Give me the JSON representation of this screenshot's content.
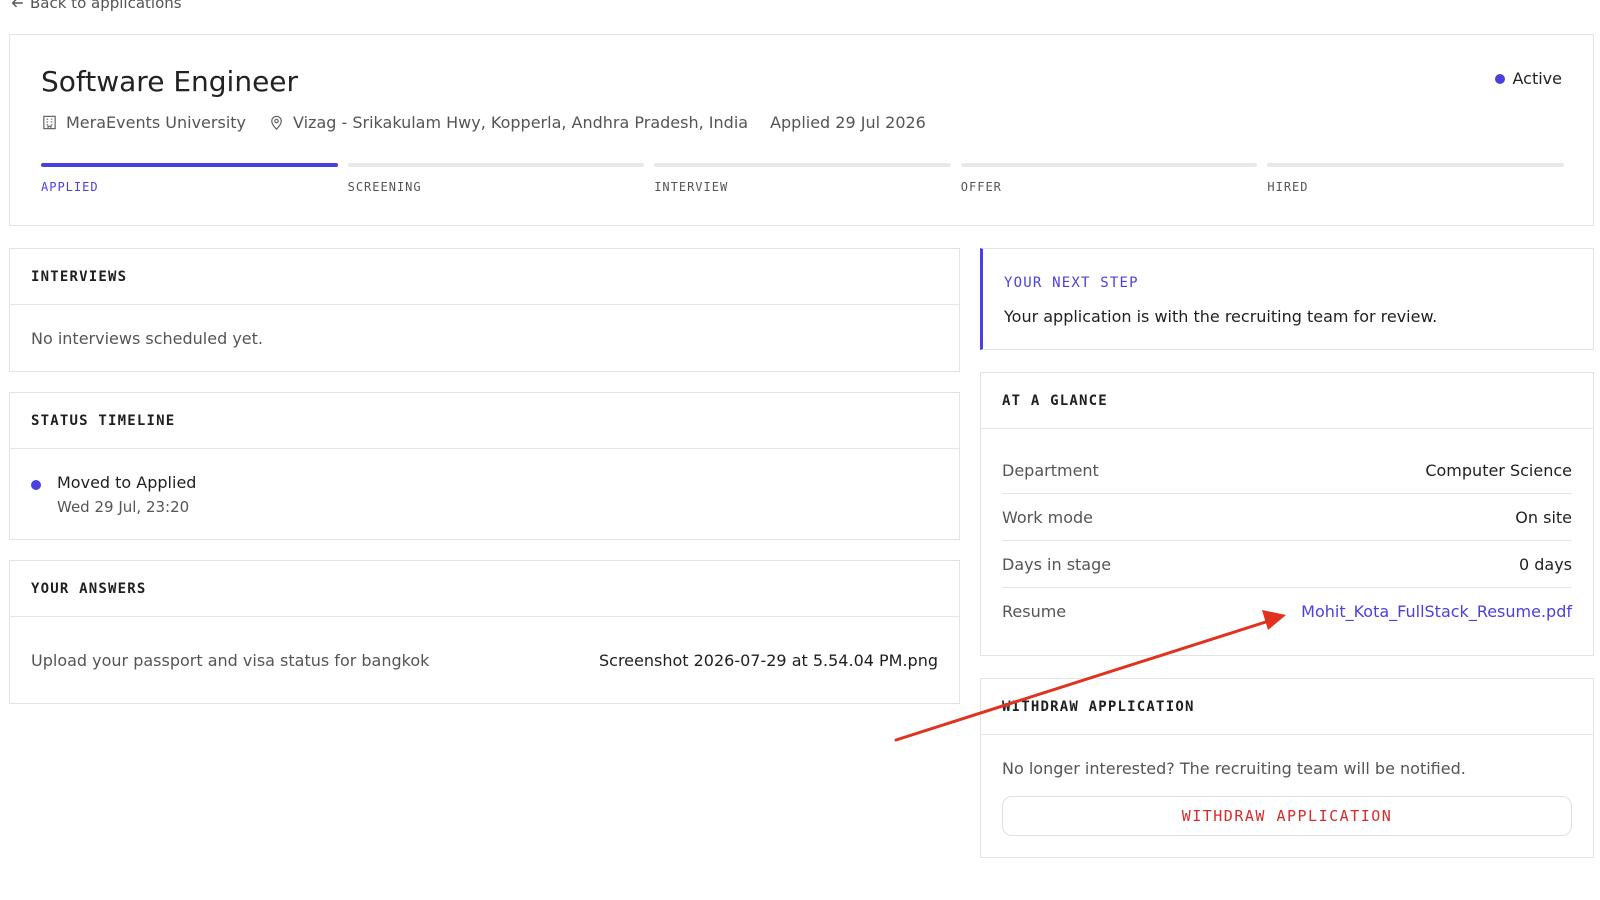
{
  "back_link": {
    "label": "Back to applications"
  },
  "header": {
    "title": "Software Engineer",
    "status": "Active",
    "organization": "MeraEvents University",
    "location": "Vizag - Srikakulam Hwy, Kopperla, Andhra Pradesh, India",
    "applied": "Applied 29 Jul 2026"
  },
  "stages": [
    "APPLIED",
    "SCREENING",
    "INTERVIEW",
    "OFFER",
    "HIRED"
  ],
  "interviews": {
    "heading": "INTERVIEWS",
    "empty_text": "No interviews scheduled yet."
  },
  "timeline": {
    "heading": "STATUS TIMELINE",
    "entries": [
      {
        "title": "Moved to Applied",
        "date": "Wed 29 Jul, 23:20"
      }
    ]
  },
  "answers": {
    "heading": "YOUR ANSWERS",
    "items": [
      {
        "question": "Upload your passport and visa status for bangkok",
        "answer": "Screenshot 2026-07-29 at 5.54.04 PM.png"
      }
    ]
  },
  "next_step": {
    "heading": "YOUR NEXT STEP",
    "text": "Your application is with the recruiting team for review."
  },
  "glance": {
    "heading": "AT A GLANCE",
    "rows": [
      {
        "key": "Department",
        "value": "Computer Science"
      },
      {
        "key": "Work mode",
        "value": "On site"
      },
      {
        "key": "Days in stage",
        "value": "0 days"
      },
      {
        "key": "Resume",
        "value": "Mohit_Kota_FullStack_Resume.pdf"
      }
    ]
  },
  "withdraw": {
    "heading": "WITHDRAW APPLICATION",
    "text": "No longer interested? The recruiting team will be notified.",
    "button_label": "WITHDRAW APPLICATION"
  },
  "colors": {
    "accent": "#4b3fe0",
    "danger": "#d62b2b",
    "annotation": "#e0321e"
  }
}
